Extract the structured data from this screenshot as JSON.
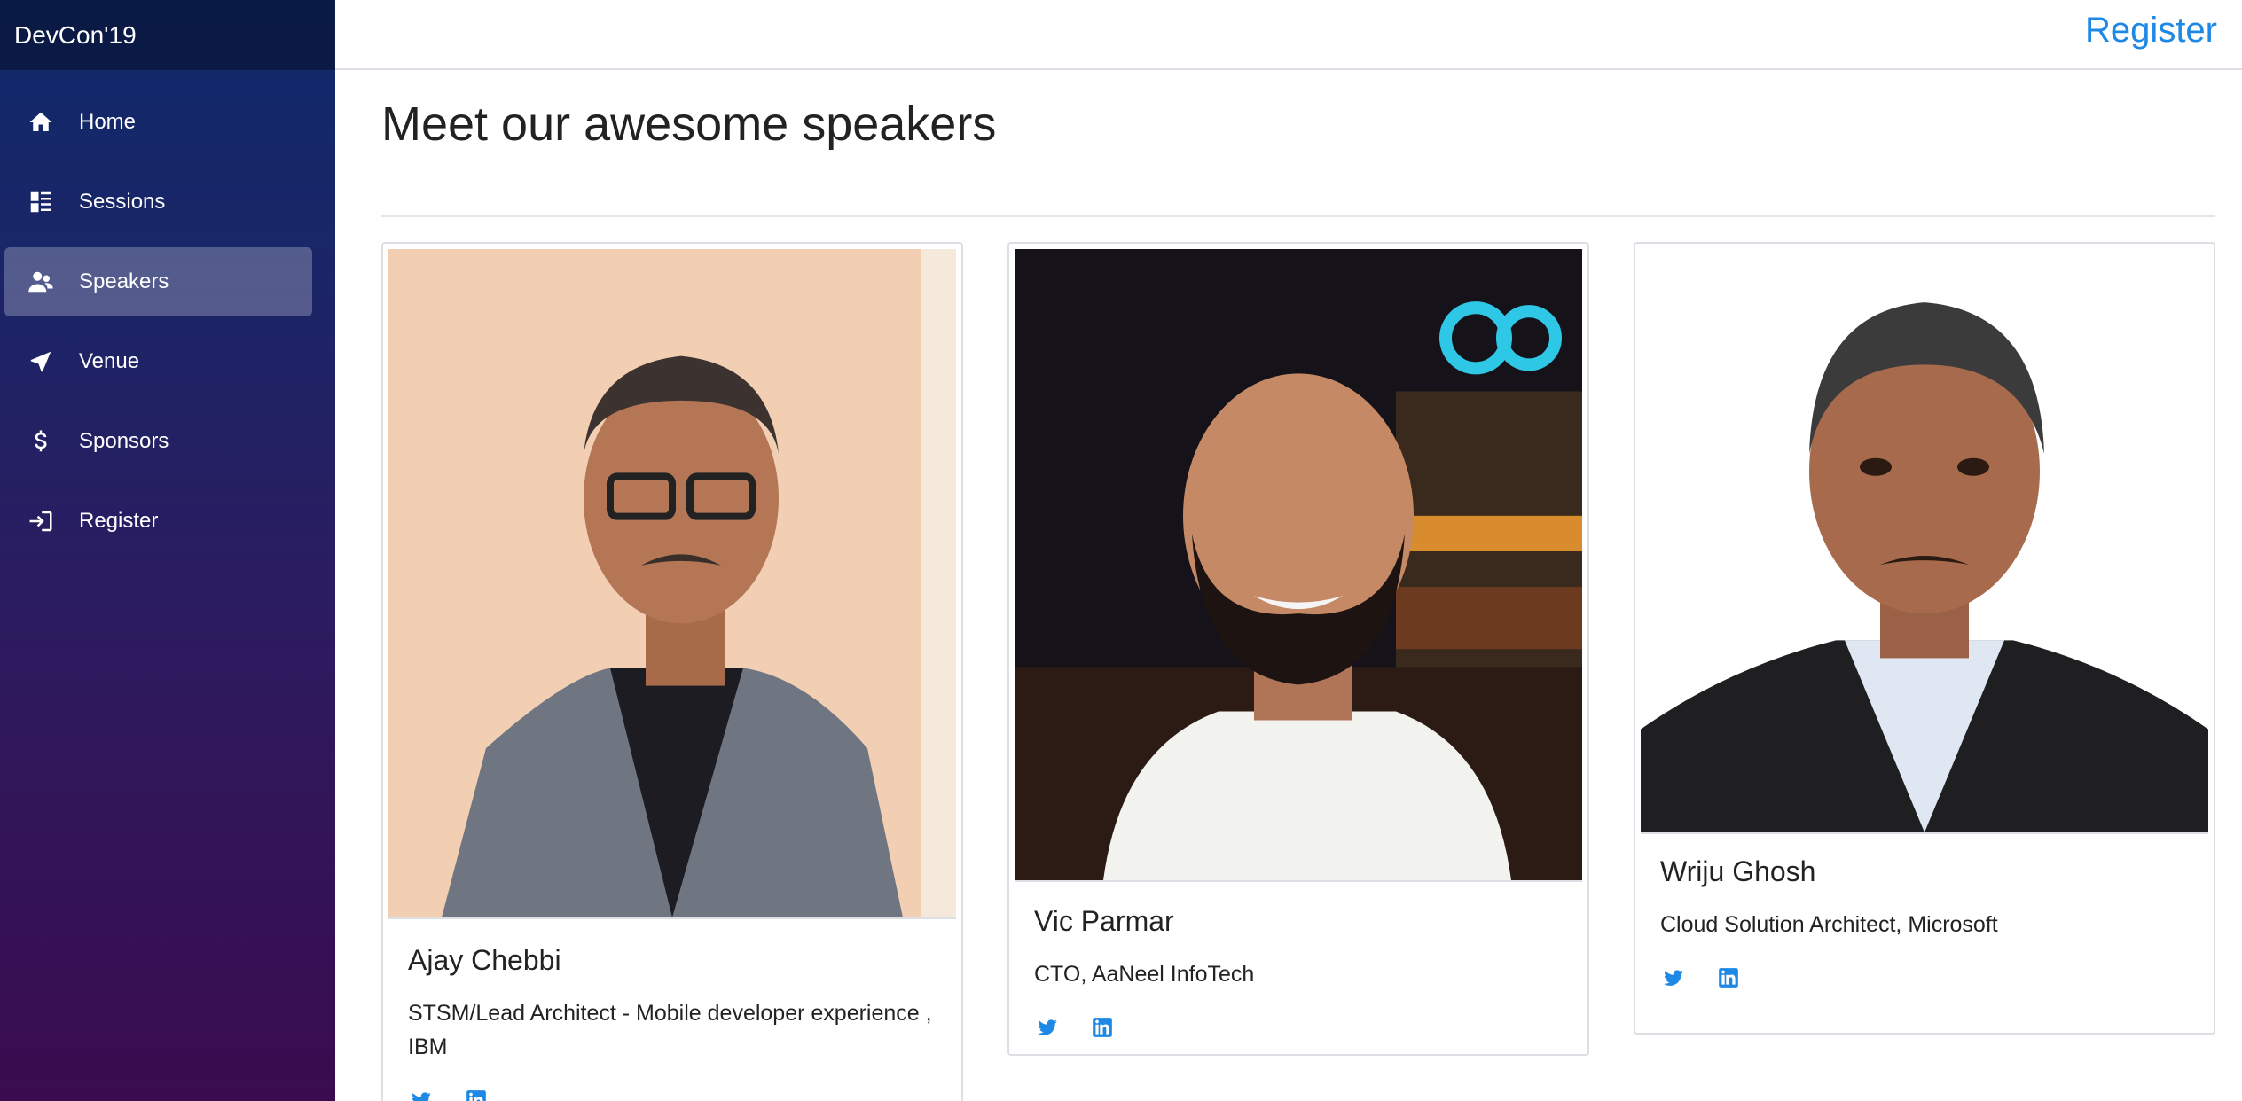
{
  "app": {
    "brand": "DevCon'19"
  },
  "sidebar": {
    "items": [
      {
        "label": "Home",
        "icon": "home-icon"
      },
      {
        "label": "Sessions",
        "icon": "list-icon"
      },
      {
        "label": "Speakers",
        "icon": "people-icon",
        "active": true
      },
      {
        "label": "Venue",
        "icon": "navigation-arrow-icon"
      },
      {
        "label": "Sponsors",
        "icon": "dollar-icon"
      },
      {
        "label": "Register",
        "icon": "login-icon"
      }
    ]
  },
  "header": {
    "register_label": "Register"
  },
  "main": {
    "title": "Meet our awesome speakers",
    "speakers": [
      {
        "name": "Ajay Chebbi",
        "title": "STSM/Lead Architect - Mobile developer experience , IBM"
      },
      {
        "name": "Vic Parmar",
        "title": "CTO, AaNeel InfoTech"
      },
      {
        "name": "Wriju Ghosh",
        "title": "Cloud Solution Architect, Microsoft"
      }
    ]
  },
  "colors": {
    "accent": "#1e88e5",
    "sidebar_top": "#0f2a6b",
    "sidebar_bottom": "#3a0b4f"
  }
}
